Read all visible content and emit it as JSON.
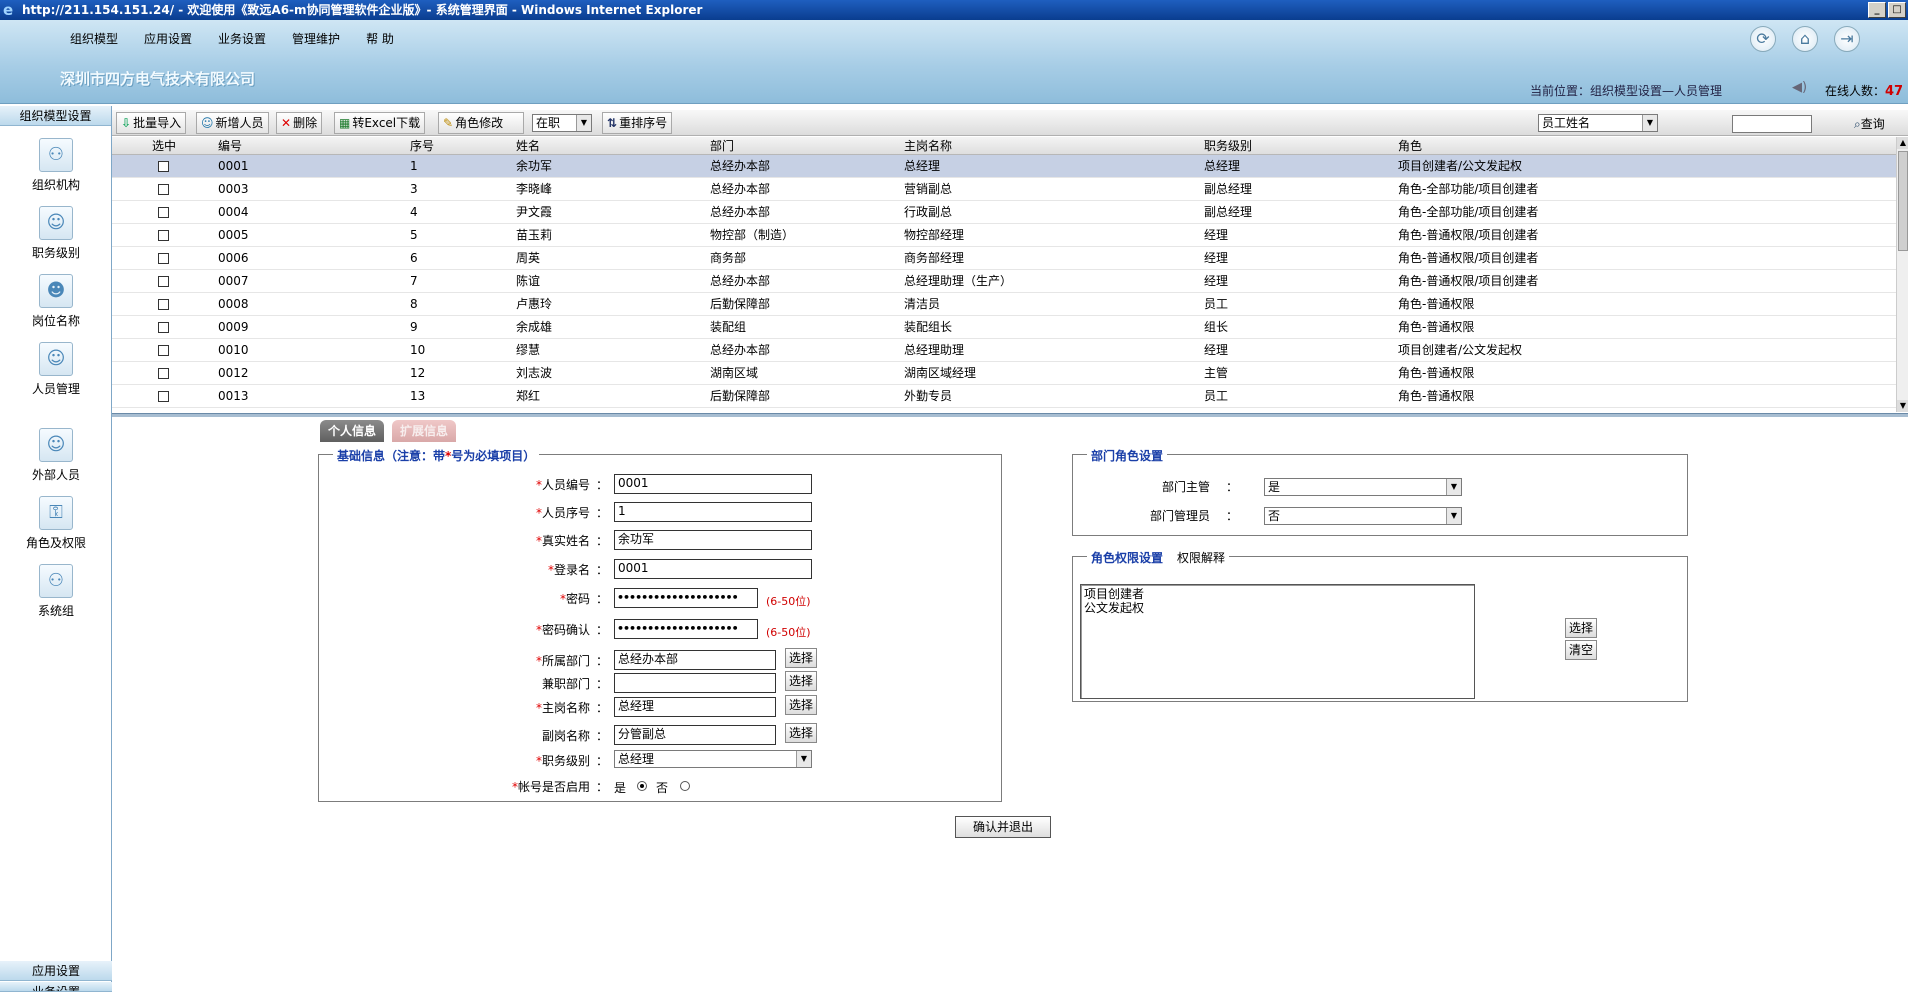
{
  "window": {
    "title": "http://211.154.151.24/ - 欢迎使用《致远A6-m协同管理软件企业版》- 系统管理界面 - Windows Internet Explorer"
  },
  "header": {
    "menu": [
      "组织模型",
      "应用设置",
      "业务设置",
      "管理维护",
      "帮 助"
    ],
    "company": "深圳市四方电气技术有限公司",
    "location": "当前位置：组织模型设置—人员管理",
    "online_label": "在线人数：",
    "online_count": "47"
  },
  "leftnav": {
    "section_title": "组织模型设置",
    "items": [
      "组织机构",
      "职务级别",
      "岗位名称",
      "人员管理",
      "外部人员",
      "角色及权限",
      "系统组"
    ],
    "bottom_sections": [
      "应用设置",
      "业务设置"
    ]
  },
  "toolbar": {
    "batch_import": "批量导入",
    "add_person": "新增人员",
    "delete": "删除",
    "export_excel": "转Excel下载",
    "role_edit": "角色修改",
    "status_select": "在职",
    "reorder": "重排序号",
    "search_field_select": "员工姓名",
    "search_input": "",
    "search": "查询"
  },
  "table": {
    "columns": [
      "选中",
      "编号",
      "序号",
      "姓名",
      "部门",
      "主岗名称",
      "职务级别",
      "角色"
    ],
    "rows": [
      [
        "0001",
        "1",
        "余功军",
        "总经办本部",
        "总经理",
        "总经理",
        "项目创建者/公文发起权"
      ],
      [
        "0003",
        "3",
        "李晓峰",
        "总经办本部",
        "营销副总",
        "副总经理",
        "角色-全部功能/项目创建者"
      ],
      [
        "0004",
        "4",
        "尹文霞",
        "总经办本部",
        "行政副总",
        "副总经理",
        "角色-全部功能/项目创建者"
      ],
      [
        "0005",
        "5",
        "苗玉莉",
        "物控部（制造）",
        "物控部经理",
        "经理",
        "角色-普通权限/项目创建者"
      ],
      [
        "0006",
        "6",
        "周英",
        "商务部",
        "商务部经理",
        "经理",
        "角色-普通权限/项目创建者"
      ],
      [
        "0007",
        "7",
        "陈谊",
        "总经办本部",
        "总经理助理（生产）",
        "经理",
        "角色-普通权限/项目创建者"
      ],
      [
        "0008",
        "8",
        "卢惠玲",
        "后勤保障部",
        "清洁员",
        "员工",
        "角色-普通权限"
      ],
      [
        "0009",
        "9",
        "余成雄",
        "装配组",
        "装配组长",
        "组长",
        "角色-普通权限"
      ],
      [
        "0010",
        "10",
        "缪慧",
        "总经办本部",
        "总经理助理",
        "经理",
        "项目创建者/公文发起权"
      ],
      [
        "0012",
        "12",
        "刘志波",
        "湖南区域",
        "湖南区域经理",
        "主管",
        "角色-普通权限"
      ],
      [
        "0013",
        "13",
        "郑红",
        "后勤保障部",
        "外勤专员",
        "员工",
        "角色-普通权限"
      ]
    ]
  },
  "tabs": [
    "个人信息",
    "扩展信息"
  ],
  "basic_info": {
    "legend": "基础信息（注意：带",
    "legend_star": "*",
    "legend_tail": "号为必填项目）",
    "fields": {
      "person_no_label": "人员编号",
      "person_no": "0001",
      "person_seq_label": "人员序号",
      "person_seq": "1",
      "real_name_label": "真实姓名",
      "real_name": "余功军",
      "login_name_label": "登录名",
      "login_name": "0001",
      "password_label": "密码",
      "password_mask": "••••••••••••••••••••",
      "password_hint": "(6-50位)",
      "password_confirm_label": "密码确认",
      "password_confirm_mask": "••••••••••••••••••••",
      "password_confirm_hint": "(6-50位)",
      "dept_label": "所属部门",
      "dept": "总经办本部",
      "concurrent_dept_label": "兼职部门",
      "concurrent_dept": "",
      "main_post_label": "主岗名称",
      "main_post": "总经理",
      "sub_post_label": "副岗名称",
      "sub_post": "分管副总",
      "level_label": "职务级别",
      "level": "总经理",
      "enabled_label": "帐号是否启用",
      "enabled_yes": "是",
      "enabled_no": "否",
      "choose": "选择",
      "colon": "："
    }
  },
  "dept_role": {
    "legend": "部门角色设置",
    "dept_manager_label": "部门主管",
    "dept_manager": "是",
    "dept_admin_label": "部门管理员",
    "dept_admin": "否"
  },
  "role_perm": {
    "legend": "角色权限设置",
    "legend_extra": "权限解释",
    "items": [
      "项目创建者",
      "公文发起权"
    ],
    "choose": "选择",
    "clear": "清空"
  },
  "confirm": "确认并退出",
  "colors": {
    "titlebar": "#0a3d8f",
    "header": "#a7cde6",
    "selected_row": "#c6d0e4",
    "legend": "#1a3fa8",
    "required": "#e00000",
    "online_count": "#d00000"
  }
}
